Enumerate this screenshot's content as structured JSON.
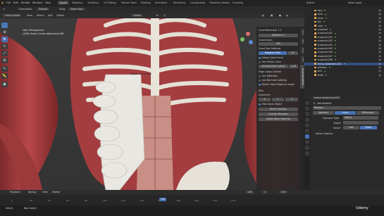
{
  "topbar": {
    "menus": [
      "File",
      "Edit",
      "Render",
      "Window",
      "Help"
    ],
    "workspaces": [
      "Layout",
      "Modeling",
      "Sculpting",
      "UV Editing",
      "Texture Paint",
      "Shading",
      "Animation",
      "Rendering",
      "Compositing",
      "Geometry Nodes",
      "Scripting"
    ],
    "active_workspace": "Layout",
    "scene_label": "Scene",
    "view_layer_label": "View Layer"
  },
  "header": {
    "orientation_label": "Orientation:",
    "orientation_value": "Default",
    "drag_label": "Drag:",
    "drag_value": "Select Box",
    "mode": "Object Mode",
    "menus": [
      "View",
      "Select",
      "Add",
      "Object"
    ],
    "transform": "Global"
  },
  "viewport": {
    "view_name": "User Perspective",
    "collection_path": "(136) Head | rectus abdominis.001",
    "object_label": "Object: Quadriflow"
  },
  "npanel": {
    "title": "Quad Remesher 1.2",
    "remesh_button": "REMESH IT",
    "quad_count_label": "Quad Count",
    "quad_count": "500",
    "quad_size_label": "Quad Size Settings",
    "adaptive_label": "Adaptive Size",
    "adaptive_value": "50",
    "adapt_quad_count": "Adapt Quad Count",
    "use_vertex_color": "Use Vertex Color",
    "density_label": "Density(vert. paint)",
    "density_value": "1.00",
    "edge_loops_label": "Edge Loops Control",
    "use_materials": "Use Materials",
    "use_normals": "Use Normals Splitting",
    "detect_hard_edges": "Detect Hard Edges by angle",
    "misc_label": "Misc",
    "symmetry_label": "Symmetry",
    "axes": [
      "X",
      "Y",
      "Z"
    ],
    "hide_input": "Hide Input Object",
    "reset_settings": "Reset Settings",
    "license_manager": "License Manager",
    "apply_material": "Apply Basic Material",
    "tabs": [
      "Item",
      "Tool",
      "View",
      "Edit",
      "Quad Remesher"
    ]
  },
  "outliner": {
    "rows": [
      {
        "name": "ears",
        "type": "mesh",
        "sel": false
      },
      {
        "name": "eyes",
        "type": "mesh",
        "sel": false
      },
      {
        "name": "head",
        "type": "mesh",
        "sel": false
      },
      {
        "name": "lips",
        "type": "mesh",
        "sel": false
      },
      {
        "name": "nose",
        "type": "mesh",
        "sel": false
      },
      {
        "name": "scaphoid",
        "type": "mesh",
        "sel": false
      },
      {
        "name": "scaphoid.001",
        "type": "mesh",
        "sel": false
      },
      {
        "name": "scaphoid.002",
        "type": "mesh",
        "sel": false
      },
      {
        "name": "scaphoid.003",
        "type": "mesh",
        "sel": false
      },
      {
        "name": "scaphoid.004",
        "type": "mesh",
        "sel": false
      },
      {
        "name": "scaphoid.005",
        "type": "mesh",
        "sel": false
      },
      {
        "name": "scaphoid.006",
        "type": "mesh",
        "sel": false
      },
      {
        "name": "scaphoid.007",
        "type": "mesh",
        "sel": false
      },
      {
        "name": "scaphoid.008",
        "type": "mesh",
        "sel": false
      },
      {
        "name": "rectus abdominis.001",
        "type": "mesh",
        "sel": true
      },
      {
        "name": "skeleton",
        "type": "mesh",
        "sel": false
      },
      {
        "name": "skin",
        "type": "mesh",
        "sel": false
      },
      {
        "name": "teeth",
        "type": "mesh",
        "sel": false
      }
    ]
  },
  "properties": {
    "object_name": "rectus abdominis.001",
    "modifier_name": "Boolean",
    "add_modifier": "Add Modifier",
    "boolean_label": "Boolean",
    "modes": [
      "Intersect",
      "Union",
      "Difference"
    ],
    "active_mode": "Union",
    "operand_type_label": "Operand Type",
    "operand_type": "Object",
    "object_label": "Object",
    "solver_label": "Solver",
    "solvers": [
      "Fast",
      "Exact"
    ],
    "active_solver": "Exact",
    "solver_options": "Solver Options"
  },
  "timeline": {
    "menus": [
      "Playback",
      "Keying",
      "View",
      "Marker"
    ],
    "current_frame": "136",
    "start": "1",
    "end": "250",
    "ticks": [
      "0",
      "20",
      "40",
      "60",
      "80",
      "100",
      "120",
      "140",
      "160",
      "180",
      "200",
      "220",
      "240"
    ]
  },
  "status": {
    "left": "Select",
    "mid": "Box Select",
    "right": "Udemy"
  },
  "colors": {
    "accent": "#4772b3",
    "muscle": "#a8383a",
    "bone": "#e4e0d5"
  }
}
